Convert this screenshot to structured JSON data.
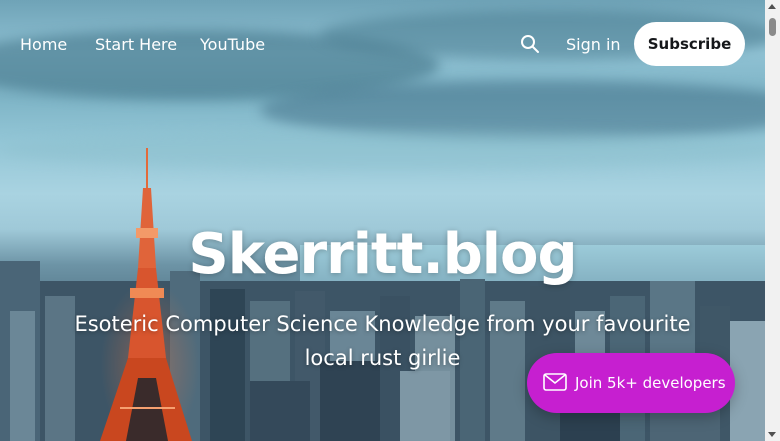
{
  "nav": {
    "links": [
      {
        "label": "Home"
      },
      {
        "label": "Start Here"
      },
      {
        "label": "YouTube"
      }
    ],
    "signin_label": "Sign in",
    "subscribe_label": "Subscribe"
  },
  "hero": {
    "title": "Skerritt.blog",
    "description": "Esoteric Computer Science Knowledge from your favourite local rust girlie"
  },
  "portal": {
    "label": "Join 5k+ developers",
    "color": "#c61fd0"
  },
  "icons": {
    "search": "search-icon",
    "mail": "mail-icon"
  }
}
